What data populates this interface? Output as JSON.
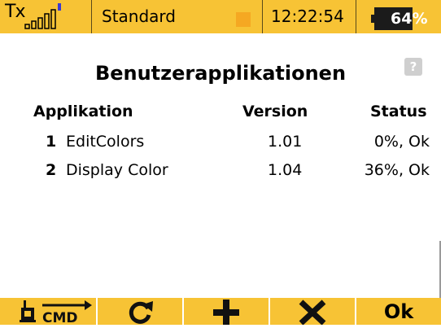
{
  "statusbar": {
    "tx_label": "Tx",
    "model_name": "Standard",
    "time": "12:22:54",
    "battery": {
      "percent_text": "64%",
      "level": 0.64
    },
    "signal_icon": "signal-strength-icon",
    "color_square": "#f5a822"
  },
  "screen": {
    "title": "Benutzerapplikationen",
    "help_icon": "?",
    "columns": {
      "app": "Applikation",
      "version": "Version",
      "status": "Status"
    },
    "apps": [
      {
        "num": "1",
        "name": "EditColors",
        "version": "1.01",
        "status": "0%, Ok"
      },
      {
        "num": "2",
        "name": "Display Color",
        "version": "1.04",
        "status": "36%, Ok"
      }
    ]
  },
  "toolbar": {
    "cmd_label": "CMD",
    "ok_label": "Ok",
    "icons": [
      "transmitter-cmd-icon",
      "refresh-icon",
      "add-icon",
      "delete-icon"
    ]
  },
  "colors": {
    "accent": "#f7c335",
    "dark": "#1b1b1b"
  }
}
